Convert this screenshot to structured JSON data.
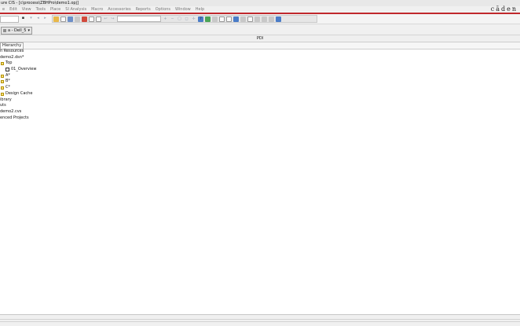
{
  "window": {
    "title": "ure CIS - [c\\process\\ZBHPro\\demo1.opj]"
  },
  "menu": {
    "items": [
      "e",
      "Edit",
      "View",
      "Tools",
      "Place",
      "SI Analysis",
      "Macro",
      "Accessories",
      "Reports",
      "Options",
      "Window",
      "Help"
    ],
    "brand": "cāden"
  },
  "toolbar": {
    "redo_glyph": "↪",
    "undo_glyph": "↩"
  },
  "doc_tab": {
    "label": "a - Dell_5"
  },
  "panel": {
    "title": "PDI"
  },
  "view_tabs": {
    "active": "Hierarchy"
  },
  "tree": {
    "design_resources": "n Resources",
    "design_file": "demo2.dsn*",
    "top": "Top",
    "overview": "01_Overview",
    "page_a": "A*",
    "page_b": "B*",
    "page_c": "C*",
    "design_cache": "Design Cache",
    "library": "ibrary",
    "outputs": "uts",
    "outputs_file": "demo2.cvs",
    "referenced_projects": "enced Projects"
  }
}
